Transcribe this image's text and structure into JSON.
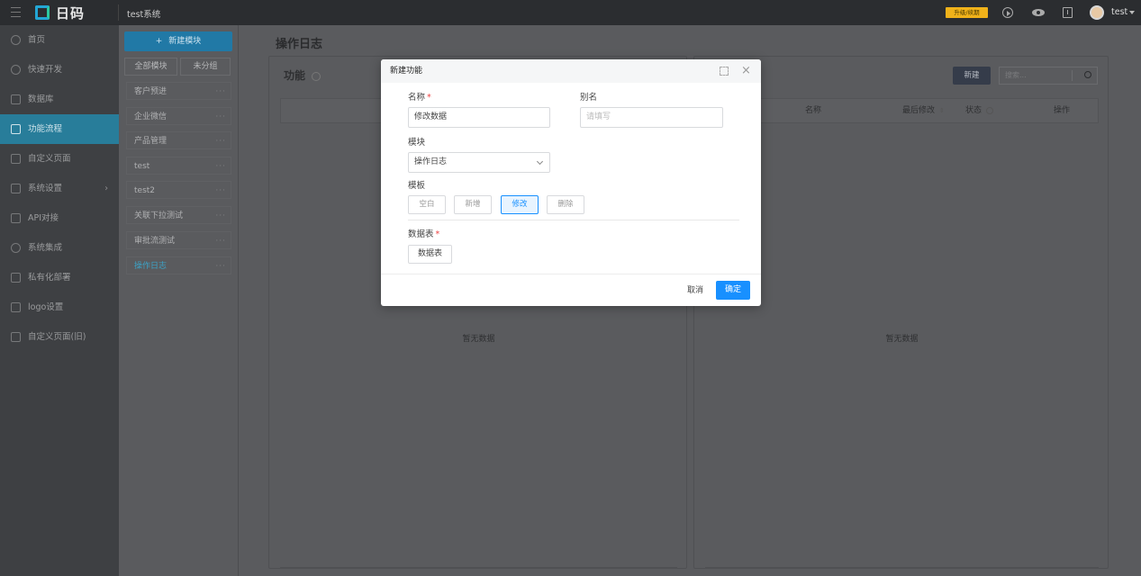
{
  "topbar": {
    "brand": "日码",
    "system_name": "test系统",
    "upgrade_label": "升级/续期",
    "username": "test",
    "colors": {
      "bg": "#2b2d30",
      "accent": "#f0b21a"
    }
  },
  "sidebar": {
    "items": [
      {
        "label": "首页",
        "icon": "home-icon"
      },
      {
        "label": "快速开发",
        "icon": "rocket-icon"
      },
      {
        "label": "数据库",
        "icon": "database-icon"
      },
      {
        "label": "功能流程",
        "icon": "flow-icon",
        "active": true
      },
      {
        "label": "自定义页面",
        "icon": "page-icon"
      },
      {
        "label": "系统设置",
        "icon": "settings-icon",
        "has_arrow": true
      },
      {
        "label": "API对接",
        "icon": "api-icon"
      },
      {
        "label": "系统集成",
        "icon": "integration-icon"
      },
      {
        "label": "私有化部署",
        "icon": "deploy-icon"
      },
      {
        "label": "logo设置",
        "icon": "logo-icon"
      },
      {
        "label": "自定义页面(旧)",
        "icon": "page-old-icon"
      }
    ],
    "active_color": "#287d9a"
  },
  "modules": {
    "new_button": "新建模块",
    "filter_all": "全部模块",
    "filter_ungrouped": "未分组",
    "items": [
      "客户预进",
      "企业微信",
      "产品管理",
      "test",
      "test2",
      "关联下拉测试",
      "审批流测试",
      "操作日志"
    ],
    "selected": "操作日志"
  },
  "main": {
    "page_title": "操作日志",
    "left_panel_title": "功能",
    "empty_text_left": "暂无数据",
    "empty_text_right": "暂无数据",
    "new_button": "新建",
    "search_placeholder": "搜索...",
    "table_headers": [
      "名称",
      "最后修改",
      "状态",
      "操作"
    ]
  },
  "modal": {
    "title": "新建功能",
    "name_label": "名称",
    "name_value": "修改数据",
    "alias_label": "别名",
    "alias_placeholder": "请填写",
    "module_label": "模块",
    "module_value": "操作日志",
    "template_label": "模板",
    "templates": [
      "空白",
      "新增",
      "修改",
      "删除"
    ],
    "template_selected": "修改",
    "table_label": "数据表",
    "table_button": "数据表",
    "cancel_label": "取消",
    "confirm_label": "确定",
    "required_mark": "*"
  }
}
